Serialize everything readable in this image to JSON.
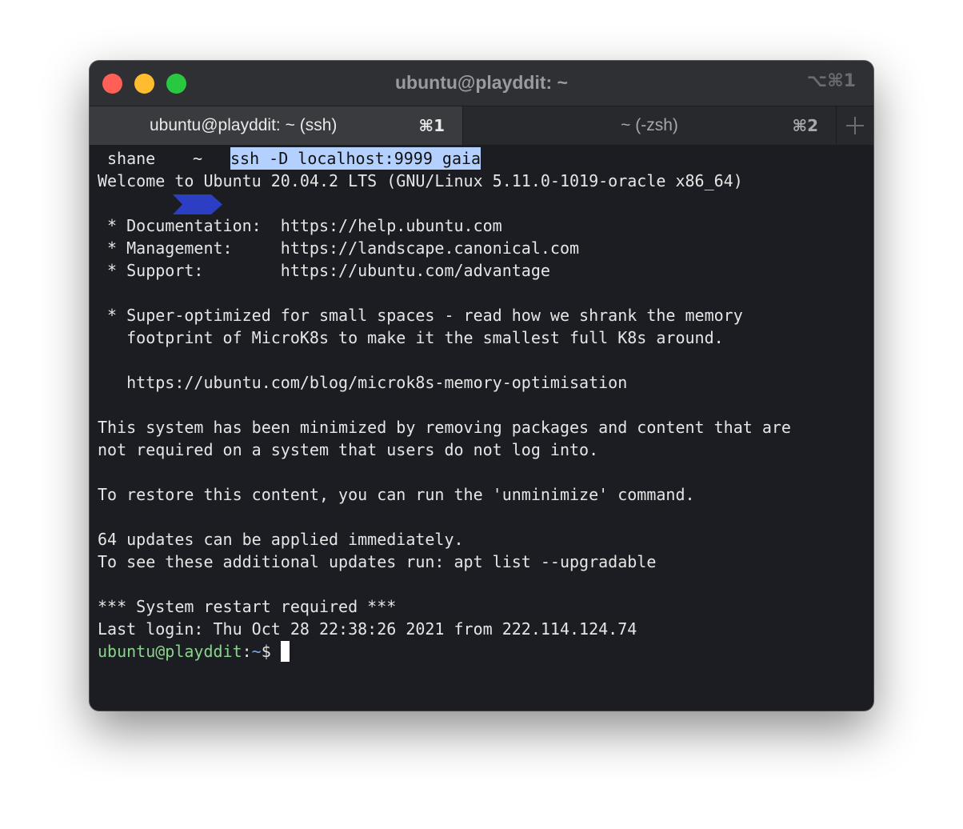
{
  "window": {
    "title": "ubuntu@playddit: ~",
    "shortcut": "⌥⌘1"
  },
  "tabs": [
    {
      "label": "ubuntu@playddit: ~ (ssh)",
      "shortcut": "⌘1",
      "active": true
    },
    {
      "label": "~ (-zsh)",
      "shortcut": "⌘2",
      "active": false
    }
  ],
  "prompt": {
    "user": "shane",
    "dir": "~",
    "command": "ssh -D localhost:9999 gaia",
    "segment_color": "#2c3fc4",
    "selection_color": "#b3d0ff"
  },
  "output": [
    "Welcome to Ubuntu 20.04.2 LTS (GNU/Linux 5.11.0-1019-oracle x86_64)",
    "",
    " * Documentation:  https://help.ubuntu.com",
    " * Management:     https://landscape.canonical.com",
    " * Support:        https://ubuntu.com/advantage",
    "",
    " * Super-optimized for small spaces - read how we shrank the memory",
    "   footprint of MicroK8s to make it the smallest full K8s around.",
    "",
    "   https://ubuntu.com/blog/microk8s-memory-optimisation",
    "",
    "This system has been minimized by removing packages and content that are",
    "not required on a system that users do not log into.",
    "",
    "To restore this content, you can run the 'unminimize' command.",
    "",
    "64 updates can be applied immediately.",
    "To see these additional updates run: apt list --upgradable",
    "",
    "*** System restart required ***",
    "Last login: Thu Oct 28 22:38:26 2021 from 222.114.124.74"
  ],
  "remote_prompt": {
    "user_host": "ubuntu@playddit",
    "colon": ":",
    "path": "~",
    "symbol": "$ "
  }
}
